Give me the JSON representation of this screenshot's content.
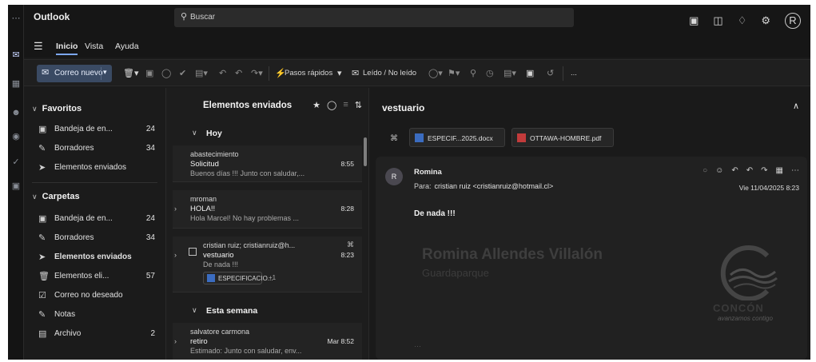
{
  "app": {
    "title": "Outlook"
  },
  "search": {
    "placeholder": "Buscar"
  },
  "user": {
    "initials": "R"
  },
  "menu": {
    "tabs": [
      "Inicio",
      "Vista",
      "Ayuda"
    ]
  },
  "ribbon": {
    "new_mail": "Correo nuevo",
    "quick_steps": "Pasos rápidos",
    "read_unread": "Leído / No leído",
    "more": "..."
  },
  "folders": {
    "favorites_label": "Favoritos",
    "favorites": [
      {
        "label": "Bandeja de en...",
        "count": "24",
        "icon": "inbox-icon"
      },
      {
        "label": "Borradores",
        "count": "34",
        "icon": "pencil-icon"
      },
      {
        "label": "Elementos enviados",
        "count": "",
        "icon": "send-icon"
      }
    ],
    "folders_label": "Carpetas",
    "items": [
      {
        "label": "Bandeja de en...",
        "count": "24",
        "icon": "inbox-icon"
      },
      {
        "label": "Borradores",
        "count": "34",
        "icon": "pencil-icon"
      },
      {
        "label": "Elementos enviados",
        "count": "",
        "icon": "send-icon"
      },
      {
        "label": "Elementos eli...",
        "count": "57",
        "icon": "trash-icon"
      },
      {
        "label": "Correo no deseado",
        "count": "",
        "icon": "junk-icon"
      },
      {
        "label": "Notas",
        "count": "",
        "icon": "note-icon"
      },
      {
        "label": "Archivo",
        "count": "2",
        "icon": "archive-icon"
      }
    ]
  },
  "list": {
    "title": "Elementos enviados",
    "groups": {
      "today": "Hoy",
      "this_week": "Esta semana"
    },
    "messages": [
      {
        "from": "abastecimiento",
        "subject": "Solicitud",
        "time": "8:55",
        "preview": "Buenos días !!! Junto con saludar,..."
      },
      {
        "from": "mroman",
        "subject": "HOLA!!",
        "time": "8:28",
        "preview": "Hola Marcel! No hay problemas ..."
      },
      {
        "from": "cristian ruiz; cristianruiz@h...",
        "subject": "vestuario",
        "time": "8:23",
        "preview": "De nada !!!",
        "attachment": "ESPECIFICACIO...",
        "attachment_more": "+1"
      },
      {
        "from": "salvatore carmona",
        "subject": "retiro",
        "time": "Mar 8:52",
        "preview": "Estimado: Junto con saludar, env..."
      }
    ]
  },
  "reading": {
    "subject": "vestuario",
    "attachments": [
      "ESPECIF...2025.docx",
      "OTTAWA-HOMBRE.pdf"
    ],
    "sender": "Romina",
    "sender_initial": "R",
    "to_label": "Para:",
    "to": "cristian ruiz <cristianruiz@hotmail.cl>",
    "date": "Vie 11/04/2025 8:23",
    "body": "De nada !!!",
    "signature_name": "Romina Allendes Villalón",
    "signature_role": "Guardaparque",
    "logo_word": "CONCÓN",
    "logo_tagline": "avanzamos contigo"
  },
  "colors": {
    "accent": "#7da7f2",
    "background": "#1b1b1b",
    "new_mail_button": "#3a4a63"
  }
}
